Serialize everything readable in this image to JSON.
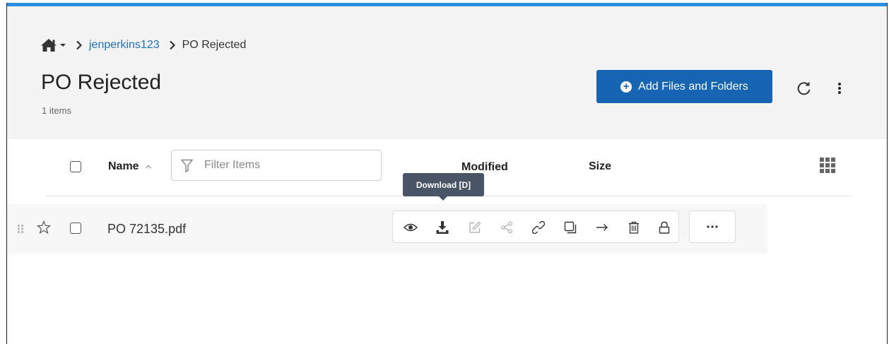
{
  "breadcrumb": {
    "home_icon": "home-icon",
    "caret_icon": "caret-down-icon",
    "separator_icon": "chevron-right-icon",
    "items": [
      {
        "label": "jenperkins123"
      },
      {
        "label": "PO Rejected"
      }
    ]
  },
  "header": {
    "title": "PO Rejected",
    "item_count": "1 items",
    "add_button_label": "Add Files and Folders",
    "refresh_icon": "refresh-icon",
    "menu_icon": "vertical-dots-icon"
  },
  "columns": {
    "name": "Name",
    "sort_icon": "sort-ascending-icon",
    "filter_placeholder": "Filter Items",
    "modified": "Modified",
    "size": "Size",
    "grid_view_icon": "grid-view-icon"
  },
  "files": [
    {
      "name": "PO 72135.pdf",
      "starred": false,
      "selected": false
    }
  ],
  "row_actions": [
    {
      "name": "preview",
      "icon": "eye-icon"
    },
    {
      "name": "download",
      "icon": "download-icon"
    },
    {
      "name": "rename",
      "icon": "edit-icon"
    },
    {
      "name": "share",
      "icon": "share-icon"
    },
    {
      "name": "link",
      "icon": "link-icon"
    },
    {
      "name": "copy",
      "icon": "copy-icon"
    },
    {
      "name": "move",
      "icon": "arrow-right-icon"
    },
    {
      "name": "delete",
      "icon": "trash-icon"
    },
    {
      "name": "lock",
      "icon": "lock-icon"
    }
  ],
  "tooltip": {
    "text": "Download [D]"
  },
  "colors": {
    "accent": "#2b8fe4",
    "primary_button": "#1565b3",
    "link": "#1f6fbf",
    "tooltip_bg": "#495566"
  }
}
